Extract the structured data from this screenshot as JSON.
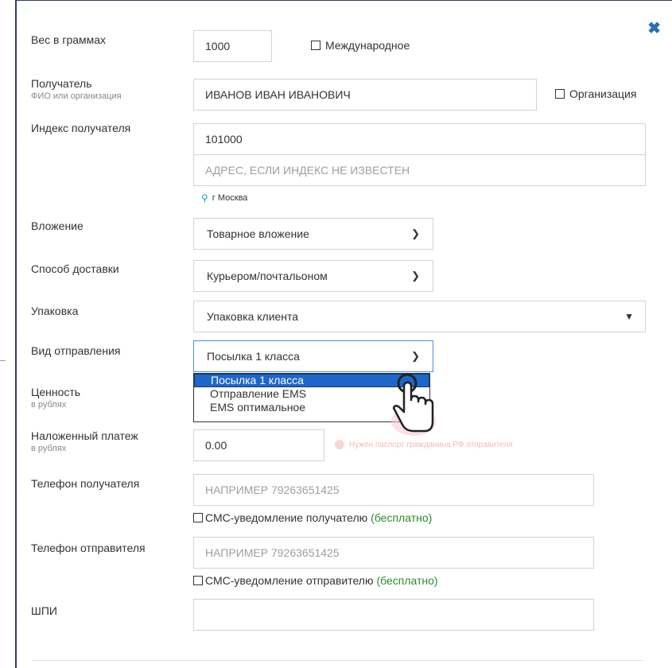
{
  "form": {
    "weight": {
      "label": "Вес в граммах",
      "value": "1000"
    },
    "international_label": "Международное",
    "recipient": {
      "label": "Получатель",
      "sublabel": "ФИО или организация",
      "value": "ИВАНОВ ИВАН ИВАНОВИЧ"
    },
    "organization_label": "Организация",
    "postcode": {
      "label": "Индекс получателя",
      "value": "101000",
      "address_placeholder": "АДРЕС, ЕСЛИ ИНДЕКС НЕ ИЗВЕСТЕН",
      "city_hint": "г Москва"
    },
    "attachment": {
      "label": "Вложение",
      "value": "Товарное вложение"
    },
    "delivery": {
      "label": "Способ доставки",
      "value": "Курьером/почтальоном"
    },
    "packaging": {
      "label": "Упаковка",
      "value": "Упаковка клиента"
    },
    "shipment_type": {
      "label": "Вид отправления",
      "value": "Посылка 1 класса",
      "options": [
        "Посылка 1 класса",
        "Отправление EMS",
        "EMS оптимальное"
      ]
    },
    "value_field": {
      "label": "Ценность",
      "sublabel": "в рублях"
    },
    "cod": {
      "label": "Наложенный платеж",
      "sublabel": "в рублях",
      "value": "0.00",
      "warning": "Нужен паспорт гражданина РФ отправителя"
    },
    "recipient_phone": {
      "label": "Телефон получателя",
      "placeholder": "НАПРИМЕР 79263651425",
      "sms_label": "СМС-уведомление получателю",
      "free_label": "(бесплатно)"
    },
    "sender_phone": {
      "label": "Телефон отправителя",
      "placeholder": "НАПРИМЕР 79263651425",
      "sms_label": "СМС-уведомление отправителю",
      "free_label": "(бесплатно)"
    },
    "shpi": {
      "label": "ШПИ",
      "value": ""
    }
  },
  "icons": {
    "close": "close-icon",
    "location": "location-pin-icon",
    "chevron": "chevron-down-icon",
    "cursor": "hand-pointer-icon"
  },
  "colors": {
    "accent": "#1e67c8",
    "close": "#2a6fb6",
    "free": "#2d8a2d",
    "pin": "#1aa5c4"
  }
}
